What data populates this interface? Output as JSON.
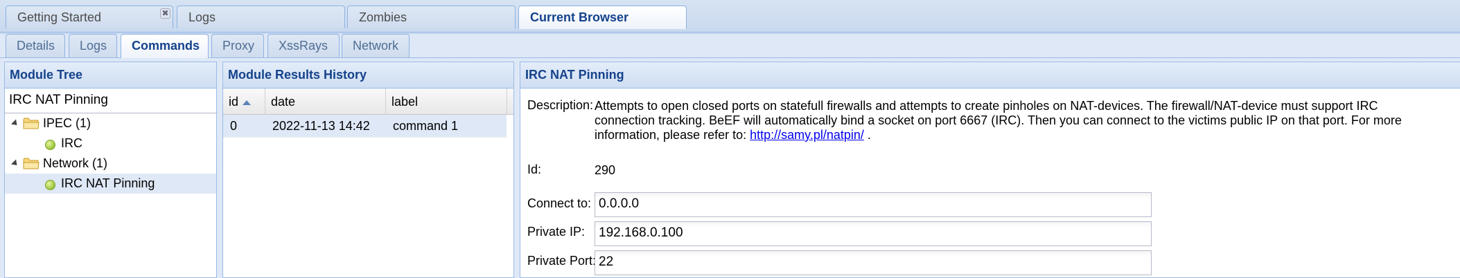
{
  "top_tabs": [
    {
      "label": "Getting Started",
      "closable": true
    },
    {
      "label": "Logs"
    },
    {
      "label": "Zombies"
    },
    {
      "label": "Current Browser",
      "active": true
    }
  ],
  "sub_tabs": [
    {
      "label": "Details"
    },
    {
      "label": "Logs"
    },
    {
      "label": "Commands",
      "active": true
    },
    {
      "label": "Proxy"
    },
    {
      "label": "XssRays"
    },
    {
      "label": "Network"
    }
  ],
  "module_tree": {
    "title": "Module Tree",
    "search_value": "IRC NAT Pinning",
    "nodes": [
      {
        "label": "IPEC (1)",
        "type": "folder"
      },
      {
        "label": "IRC",
        "type": "leaf"
      },
      {
        "label": "Network (1)",
        "type": "folder"
      },
      {
        "label": "IRC NAT Pinning",
        "type": "leaf",
        "selected": true
      }
    ]
  },
  "results_history": {
    "title": "Module Results History",
    "columns": [
      "id",
      "date",
      "label"
    ],
    "rows": [
      {
        "id": "0",
        "date": "2022-11-13 14:42",
        "label": "command 1"
      }
    ]
  },
  "module_details": {
    "title": "IRC NAT Pinning",
    "description_label": "Description:",
    "description_text": "Attempts to open closed ports on statefull firewalls and attempts to create pinholes on NAT-devices. The firewall/NAT-device must support IRC connection tracking. BeEF will automatically bind a socket on port 6667 (IRC). Then you can connect to the victims public IP on that port. For more information, please refer to:",
    "description_link": "http://samy.pl/natpin/",
    "description_tail": " .",
    "id_label": "Id:",
    "id_value": "290",
    "fields": [
      {
        "label": "Connect to:",
        "value": "0.0.0.0"
      },
      {
        "label": "Private IP:",
        "value": "192.168.0.100"
      },
      {
        "label": "Private Port:",
        "value": "22"
      }
    ]
  },
  "colors": {
    "header_text": "#15428b",
    "panel_border": "#99bbe8",
    "selected_row": "#dfe8f6",
    "link": "#0000ee"
  },
  "icons": {
    "folder": "folder-icon",
    "leaf": "module-leaf-icon",
    "close": "close-icon",
    "sort": "sort-asc-icon"
  }
}
